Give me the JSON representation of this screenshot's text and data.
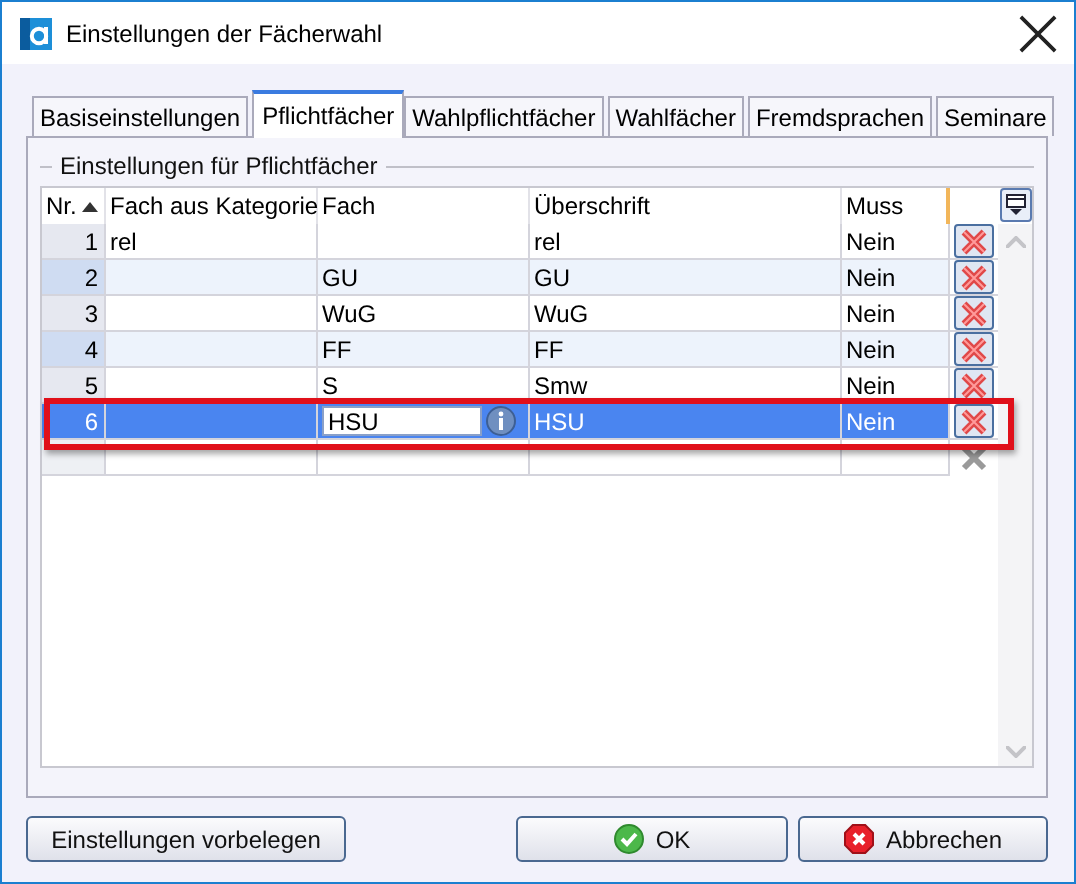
{
  "window": {
    "title": "Einstellungen der Fächerwahl"
  },
  "tabs": [
    {
      "label": "Basiseinstellungen",
      "selected": false
    },
    {
      "label": "Pflichtfächer",
      "selected": true
    },
    {
      "label": "Wahlpflichtfächer",
      "selected": false
    },
    {
      "label": "Wahlfächer",
      "selected": false
    },
    {
      "label": "Fremdsprachen",
      "selected": false
    },
    {
      "label": "Seminare",
      "selected": false
    }
  ],
  "group": {
    "title": "Einstellungen für Pflichtfächer"
  },
  "table": {
    "columns": [
      {
        "label": "Nr.",
        "sorted": true
      },
      {
        "label": "Fach aus Kategorie",
        "sorted": false
      },
      {
        "label": "Fach",
        "sorted": false
      },
      {
        "label": "Überschrift",
        "sorted": false
      },
      {
        "label": "Muss",
        "sorted": false
      }
    ],
    "rows": [
      {
        "nr": "1",
        "kategorie": "rel",
        "fach": "",
        "ueberschrift": "rel",
        "muss": "Nein",
        "selected": false,
        "editing": false
      },
      {
        "nr": "2",
        "kategorie": "",
        "fach": "GU",
        "ueberschrift": "GU",
        "muss": "Nein",
        "selected": false,
        "editing": false
      },
      {
        "nr": "3",
        "kategorie": "",
        "fach": "WuG",
        "ueberschrift": "WuG",
        "muss": "Nein",
        "selected": false,
        "editing": false
      },
      {
        "nr": "4",
        "kategorie": "",
        "fach": "FF",
        "ueberschrift": "FF",
        "muss": "Nein",
        "selected": false,
        "editing": false
      },
      {
        "nr": "5",
        "kategorie": "",
        "fach": "S",
        "ueberschrift": "Smw",
        "muss": "Nein",
        "selected": false,
        "editing": false
      },
      {
        "nr": "6",
        "kategorie": "",
        "fach": "HSU",
        "ueberschrift": "HSU",
        "muss": "Nein",
        "selected": true,
        "editing": true
      }
    ],
    "new_row": true
  },
  "buttons": [
    {
      "label": "Einstellungen vorbelegen",
      "kind": "plain"
    },
    {
      "label": "OK",
      "kind": "ok"
    },
    {
      "label": "Abbrechen",
      "kind": "cancel"
    }
  ]
}
